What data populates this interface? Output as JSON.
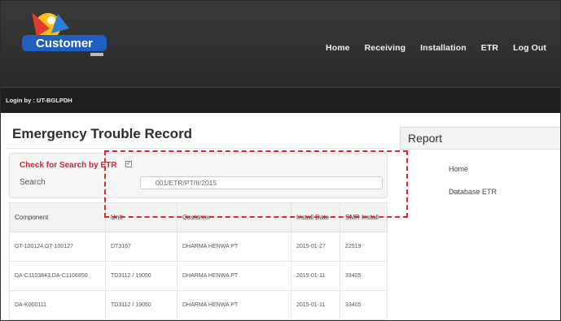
{
  "app": {
    "logo_text": "Customer"
  },
  "nav": {
    "items": [
      {
        "label": "Home"
      },
      {
        "label": "Receiving"
      },
      {
        "label": "Installation"
      },
      {
        "label": "ETR"
      },
      {
        "label": "Log Out"
      }
    ]
  },
  "login": {
    "text": "Login by : UT-BGLPDH"
  },
  "page": {
    "title": "Emergency Trouble Record"
  },
  "search": {
    "check_label": "Check for Search by ETR",
    "checked": true,
    "label": "Search",
    "value": "001/ETR/PT/II/2015"
  },
  "table": {
    "headers": [
      "Component",
      "Unit",
      "Customer",
      "Install Date",
      "SMR Install"
    ],
    "rows": [
      [
        "GT-100124,GT-100127",
        "DT3167",
        "DHARMA HENWA PT",
        "2015-01-27",
        "22519"
      ],
      [
        "DA-C1103843,DA-C1106850",
        "TD3112 / 19050",
        "DHARMA HENWA PT",
        "2015-01-11",
        "33405"
      ],
      [
        "DA-K000111",
        "TD3112 / 19050",
        "DHARMA HENWA PT",
        "2015-01-11",
        "33405"
      ]
    ]
  },
  "report": {
    "title": "Report",
    "items": [
      {
        "label": "Home"
      },
      {
        "label": "Database ETR"
      }
    ]
  },
  "colors": {
    "navbar": "#2f2f2f",
    "loginbar": "#1f1f1f",
    "accent_red": "#d9232e",
    "highlight": "#e3262e"
  }
}
